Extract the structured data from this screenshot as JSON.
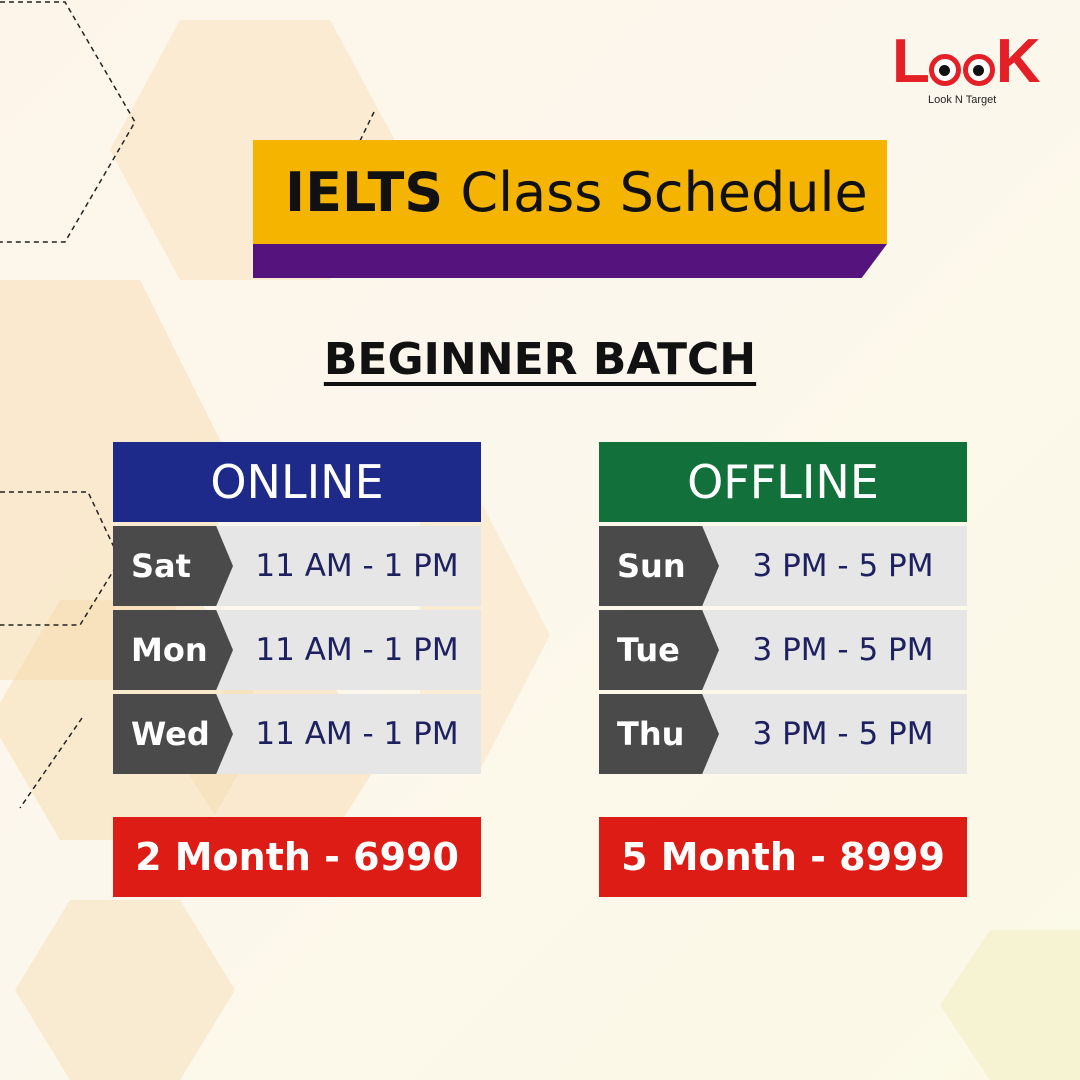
{
  "brand": {
    "logo_letters": [
      "L",
      "o",
      "o",
      "K"
    ],
    "tagline": "Look N Target",
    "color": "#e41f26"
  },
  "title": {
    "bold": "IELTS",
    "regular": "Class Schedule"
  },
  "subtitle": "BEGINNER BATCH",
  "online": {
    "heading": "ONLINE",
    "color": "#1e2a8a",
    "rows": [
      {
        "day": "Sat",
        "time": "11 AM - 1 PM"
      },
      {
        "day": "Mon",
        "time": "11 AM - 1 PM"
      },
      {
        "day": "Wed",
        "time": "11 AM - 1 PM"
      }
    ],
    "price": "2 Month - 6990"
  },
  "offline": {
    "heading": "OFFLINE",
    "color": "#12703a",
    "rows": [
      {
        "day": "Sun",
        "time": "3 PM - 5 PM"
      },
      {
        "day": "Tue",
        "time": "3 PM - 5 PM"
      },
      {
        "day": "Thu",
        "time": "3 PM - 5 PM"
      }
    ],
    "price": "5 Month - 8999"
  },
  "colors": {
    "banner_yellow": "#f5b400",
    "banner_purple": "#55137e",
    "price_red": "#dd1d15",
    "day_gray": "#4a4a4a"
  }
}
